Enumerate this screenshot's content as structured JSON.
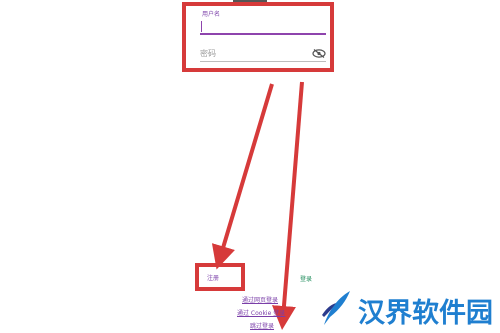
{
  "form": {
    "username_label": "用户名",
    "username_value": "",
    "password_placeholder": "密码",
    "password_toggle_icon": "eye-off-icon"
  },
  "actions": {
    "register_label": "注册",
    "login_label": "登录",
    "alt_login_1": "通过网页登录",
    "alt_login_2": "通过 Cookie 登录",
    "alt_login_3": "跳过登录"
  },
  "watermark": {
    "text": "汉界软件园",
    "icon": "feather-logo"
  },
  "colors": {
    "highlight": "#d63a3a",
    "accent": "#8e44ad",
    "login_green": "#1e8c5a",
    "watermark_blue": "#1f7fd0"
  }
}
